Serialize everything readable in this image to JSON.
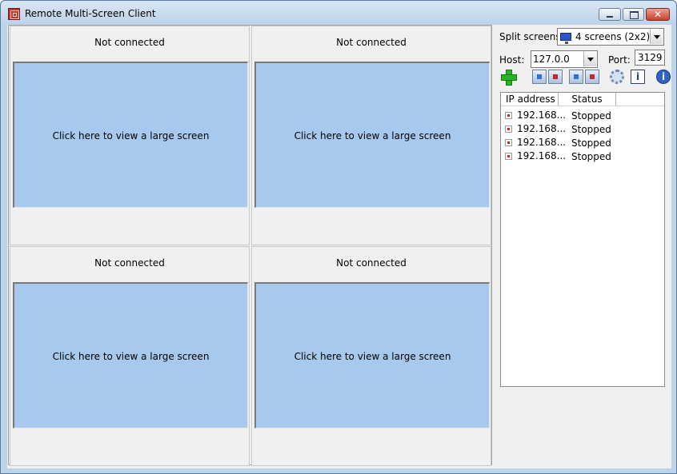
{
  "window": {
    "title": "Remote Multi-Screen Client"
  },
  "screens": [
    {
      "status": "Not connected",
      "prompt": "Click here to view a large screen"
    },
    {
      "status": "Not connected",
      "prompt": "Click here to view a large screen"
    },
    {
      "status": "Not connected",
      "prompt": "Click here to view a large screen"
    },
    {
      "status": "Not connected",
      "prompt": "Click here to view a large screen"
    }
  ],
  "side": {
    "split_label": "Split screens:",
    "split_value": "4 screens (2x2)",
    "host_label": "Host:",
    "host_value": "127.0.0",
    "port_label": "Port:",
    "port_value": "3129"
  },
  "list": {
    "headers": [
      "IP address",
      "Status"
    ],
    "rows": [
      {
        "ip": "192.168...",
        "status": "Stopped"
      },
      {
        "ip": "192.168...",
        "status": "Stopped"
      },
      {
        "ip": "192.168...",
        "status": "Stopped"
      },
      {
        "ip": "192.168...",
        "status": "Stopped"
      }
    ]
  },
  "icons": {
    "app": "remote-screen-icon",
    "split": "monitor-icon",
    "tools": [
      "add-icon",
      "play-all-icon",
      "stop-all-icon",
      "play-icon",
      "stop-icon",
      "settings-icon",
      "properties-icon",
      "about-icon"
    ],
    "row": "stopped-icon"
  },
  "colors": {
    "screen_fill": "#a8c9ee",
    "title_gradient_top": "#d9e7f5",
    "close_button": "#c7422b"
  }
}
